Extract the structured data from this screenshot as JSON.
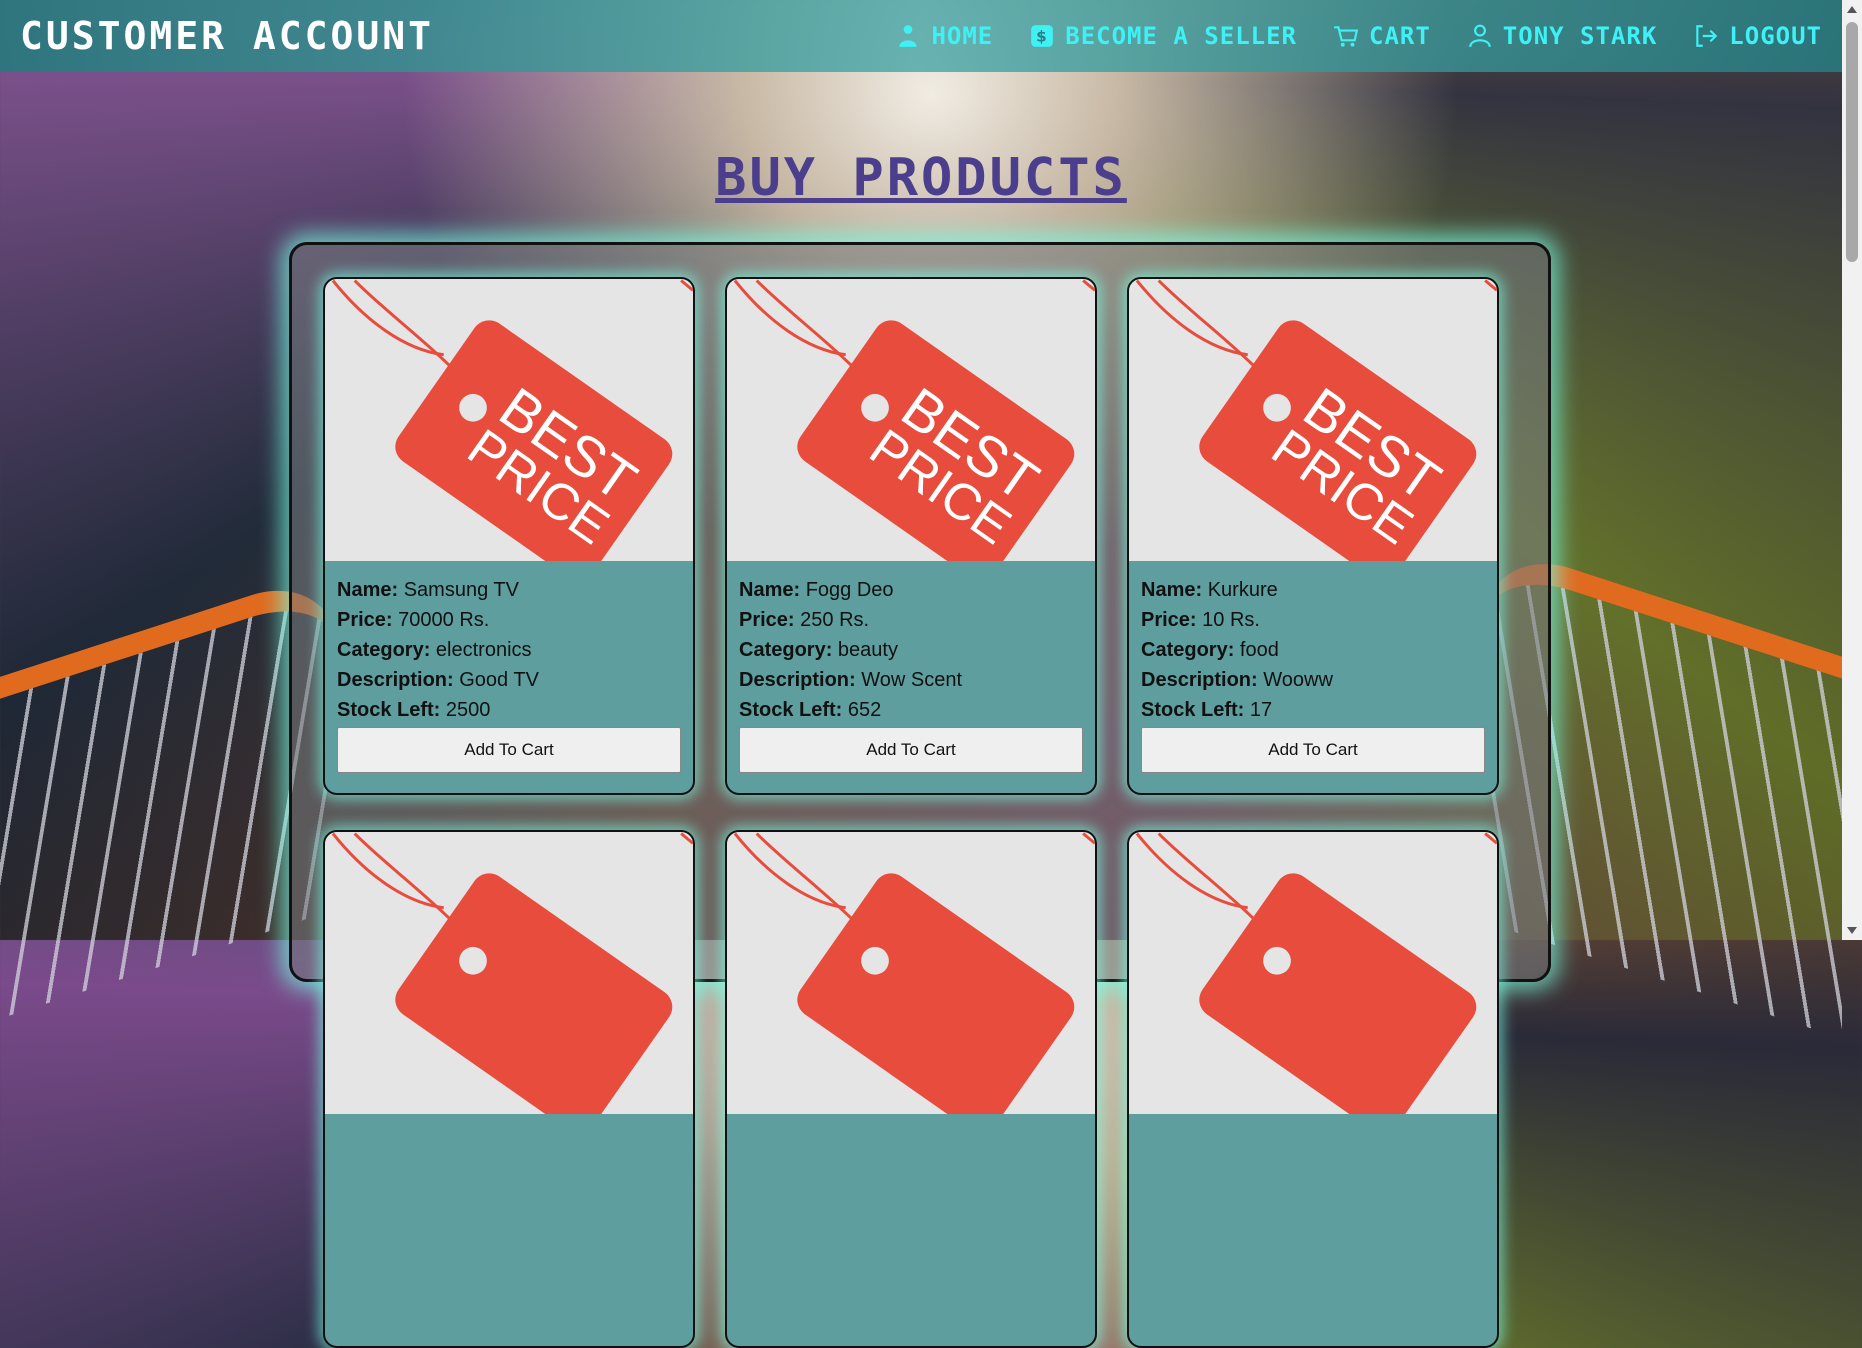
{
  "app": {
    "brand": "CUSTOMER ACCOUNT"
  },
  "nav": {
    "home": "HOME",
    "become_seller": "BECOME A SELLER",
    "cart": "CART",
    "user": "TONY STARK",
    "logout": "LOGOUT"
  },
  "page_title": "BUY PRODUCTS",
  "labels": {
    "name": "Name:",
    "price": "Price:",
    "category": "Category:",
    "description": "Description:",
    "stock": "Stock Left:"
  },
  "image_text": {
    "line1": "BEST",
    "line2": "PRICE"
  },
  "products": [
    {
      "name": "Samsung TV",
      "price": "70000 Rs.",
      "category": "electronics",
      "description": "Good TV",
      "stock": "2500",
      "button": "Add To Cart"
    },
    {
      "name": "Fogg Deo",
      "price": "250 Rs.",
      "category": "beauty",
      "description": "Wow Scent",
      "stock": "652",
      "button": "Add To Cart"
    },
    {
      "name": "Kurkure",
      "price": "10 Rs.",
      "category": "food",
      "description": "Wooww",
      "stock": "17",
      "button": "Add To Cart"
    }
  ],
  "colors": {
    "nav_text": "#3ff0f5",
    "title": "#4b3e8c",
    "card_body": "#5f9e9f",
    "tag_red": "#e74c3c",
    "glow": "#78ffe6"
  }
}
